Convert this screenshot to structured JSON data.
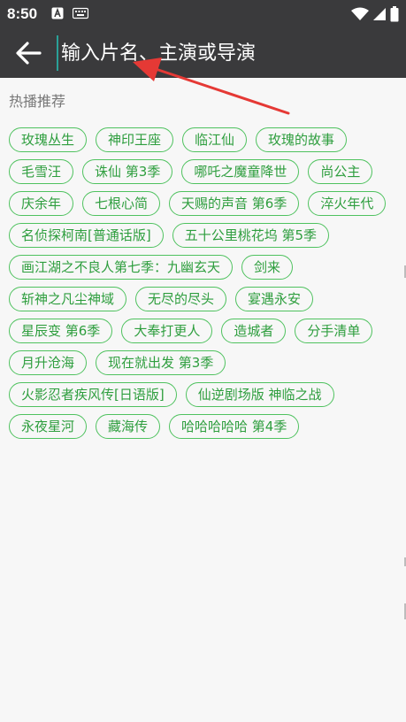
{
  "status_bar": {
    "time": "8:50"
  },
  "search": {
    "placeholder": "输入片名、主演或导演"
  },
  "section": {
    "title": "热播推荐"
  },
  "tags": [
    "玫瑰丛生",
    "神印王座",
    "临江仙",
    "玫瑰的故事",
    "毛雪汪",
    "诛仙 第3季",
    "哪吒之魔童降世",
    "尚公主",
    "庆余年",
    "七根心简",
    "天赐的声音 第6季",
    "淬火年代",
    "名侦探柯南[普通话版]",
    "五十公里桃花坞 第5季",
    "画江湖之不良人第七季：九幽玄天",
    "剑来",
    "斩神之凡尘神域",
    "无尽的尽头",
    "宴遇永安",
    "星辰变 第6季",
    "大奉打更人",
    "造城者",
    "分手清单",
    "月升沧海",
    "现在就出发 第3季",
    "火影忍者疾风传[日语版]",
    "仙逆剧场版 神临之战",
    "永夜星河",
    "藏海传",
    "哈哈哈哈哈 第4季"
  ],
  "colors": {
    "bar_bg": "#3a3a3c",
    "tag_border": "#4fc25f",
    "tag_text": "#2e9e3e",
    "annotation_arrow": "#e53935"
  }
}
